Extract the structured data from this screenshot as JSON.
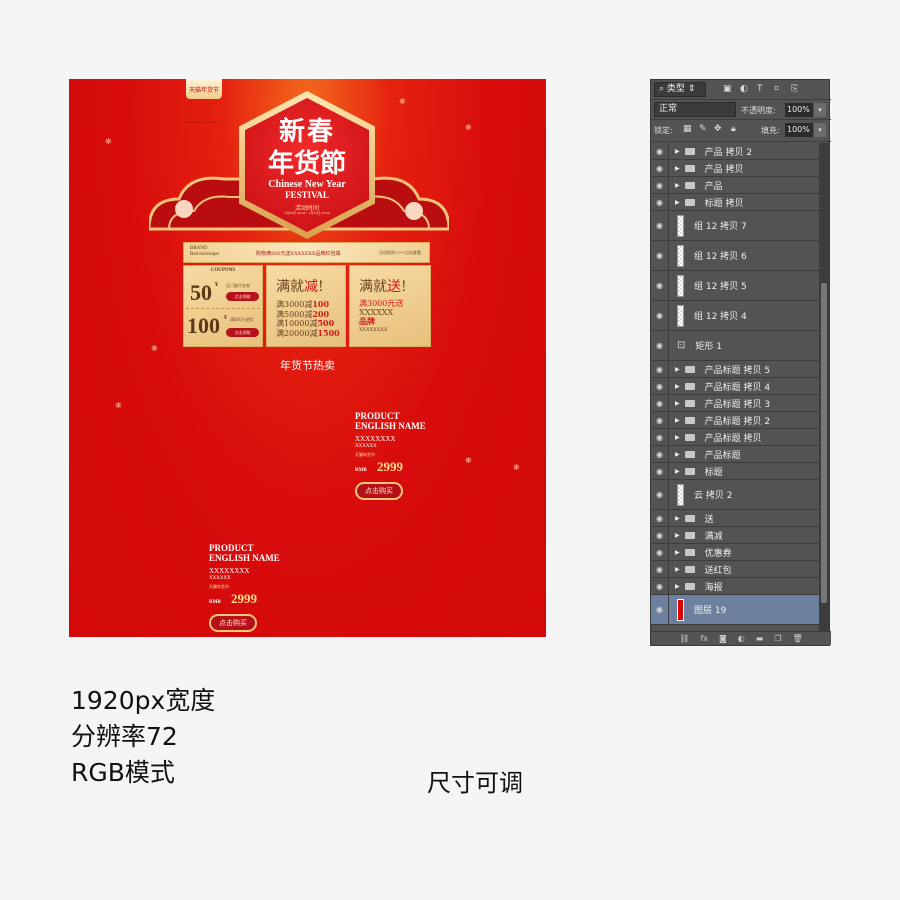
{
  "poster": {
    "ribbon_text": "天猫年货节",
    "small_tag": "Chinese New Year Festival",
    "title_line1": "新春",
    "title_line2": "年货節",
    "english_line1": "Chinese New Year",
    "english_line2": "FESTIVAL",
    "activity_label": "活动时间",
    "activity_time": "1月20日 00:00 - 1月31日 23:59",
    "brand_bar": {
      "brand_line1": "BRAND",
      "brand_line2": "Red envelopes",
      "message": "购物满500元送XXXXXXX品牌红包袋",
      "more": "活动规则>>>点击查看"
    },
    "coupons": {
      "heading": "COUPONS",
      "items": [
        {
          "amount": "50",
          "unit": "¥",
          "desc": "无门槛代金券",
          "button": "点击领取"
        },
        {
          "amount": "100",
          "unit": "¥",
          "desc": "满800元使用",
          "button": "点击领取"
        }
      ]
    },
    "discount_card": {
      "title_a": "满就",
      "title_b": "减",
      "title_c": "!",
      "lines": [
        {
          "a": "满3000减",
          "b": "100"
        },
        {
          "a": "满5000减",
          "b": "200"
        },
        {
          "a": "满10000减",
          "b": "500"
        },
        {
          "a": "满20000减",
          "b": "1500"
        }
      ]
    },
    "gift_card": {
      "title_a": "满就",
      "title_b": "送",
      "title_c": "!",
      "line1": "满3000元送",
      "line2": "XXXXXX",
      "line3": "品牌",
      "line4": "XXXXXXXX"
    },
    "hot_title": "年货节热卖",
    "products": [
      {
        "name1": "PRODUCT",
        "name2": "ENGLISH NAME",
        "x1": "XXXXXXXX",
        "x2": "XXXXXX",
        "tag": "天猫年货节",
        "rmb": "RMB",
        "price": "2999",
        "button": "点击购买"
      },
      {
        "name1": "PRODUCT",
        "name2": "ENGLISH NAME",
        "x1": "XXXXXXXX",
        "x2": "XXXXXX",
        "tag": "天猫年货节",
        "rmb": "RMB",
        "price": "2999",
        "button": "点击购买"
      }
    ]
  },
  "captions": {
    "line1": "1920px宽度",
    "line2": "分辨率72",
    "line3": "RGB模式",
    "adjustable": "尺寸可调"
  },
  "layers_panel": {
    "filter": "类型",
    "blend_mode": "正常",
    "opacity_label": "不透明度:",
    "opacity": "100%",
    "lock_label": "锁定:",
    "fill_label": "填充:",
    "fill": "100%",
    "layers": [
      {
        "name": "产品 拷贝 2",
        "type": "group"
      },
      {
        "name": "产品 拷贝",
        "type": "group"
      },
      {
        "name": "产品",
        "type": "group"
      },
      {
        "name": "标题 拷贝",
        "type": "group"
      },
      {
        "name": "组 12 拷贝 7",
        "type": "layer"
      },
      {
        "name": "组 12 拷贝 6",
        "type": "layer"
      },
      {
        "name": "组 12 拷贝 5",
        "type": "layer"
      },
      {
        "name": "组 12 拷贝 4",
        "type": "layer"
      },
      {
        "name": "矩形 1",
        "type": "shape"
      },
      {
        "name": "产品标题 拷贝 5",
        "type": "group"
      },
      {
        "name": "产品标题 拷贝 4",
        "type": "group"
      },
      {
        "name": "产品标题 拷贝 3",
        "type": "group"
      },
      {
        "name": "产品标题 拷贝 2",
        "type": "group"
      },
      {
        "name": "产品标题 拷贝",
        "type": "group"
      },
      {
        "name": "产品标题",
        "type": "group"
      },
      {
        "name": "标题",
        "type": "group"
      },
      {
        "name": "云 拷贝 2",
        "type": "layer"
      },
      {
        "name": "送",
        "type": "group"
      },
      {
        "name": "满减",
        "type": "group"
      },
      {
        "name": "优惠券",
        "type": "group"
      },
      {
        "name": "送红包",
        "type": "group"
      },
      {
        "name": "海报",
        "type": "group"
      },
      {
        "name": "图层 19",
        "type": "selected"
      }
    ]
  },
  "colors": {
    "poster_red": "#d80c0c",
    "gold": "#f0cf93",
    "panel_bg": "#535353",
    "selected_layer": "#6d809e"
  }
}
